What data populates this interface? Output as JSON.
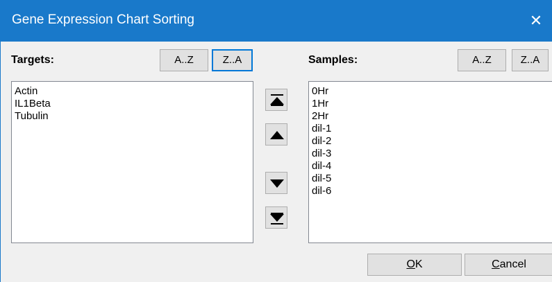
{
  "window": {
    "title": "Gene Expression Chart Sorting",
    "close_glyph": "✕"
  },
  "targets": {
    "label": "Targets:",
    "sort_az": "A..Z",
    "sort_za": "Z..A",
    "items": [
      "Actin",
      "IL1Beta",
      "Tubulin"
    ]
  },
  "samples": {
    "label": "Samples:",
    "sort_az": "A..Z",
    "sort_za": "Z..A",
    "items": [
      "0Hr",
      "1Hr",
      "2Hr",
      "dil-1",
      "dil-2",
      "dil-3",
      "dil-4",
      "dil-5",
      "dil-6"
    ]
  },
  "move_buttons": {
    "icons": [
      "move-to-top-icon",
      "move-up-icon",
      "move-down-icon",
      "move-to-bottom-icon"
    ]
  },
  "buttons": {
    "ok": {
      "mnemonic": "O",
      "rest": "K"
    },
    "cancel": {
      "mnemonic": "C",
      "rest": "ancel"
    }
  },
  "colors": {
    "titlebar": "#1979ca",
    "focus_border": "#0078d7",
    "button_face": "#e1e1e1",
    "window_bg": "#f0f0f0"
  }
}
